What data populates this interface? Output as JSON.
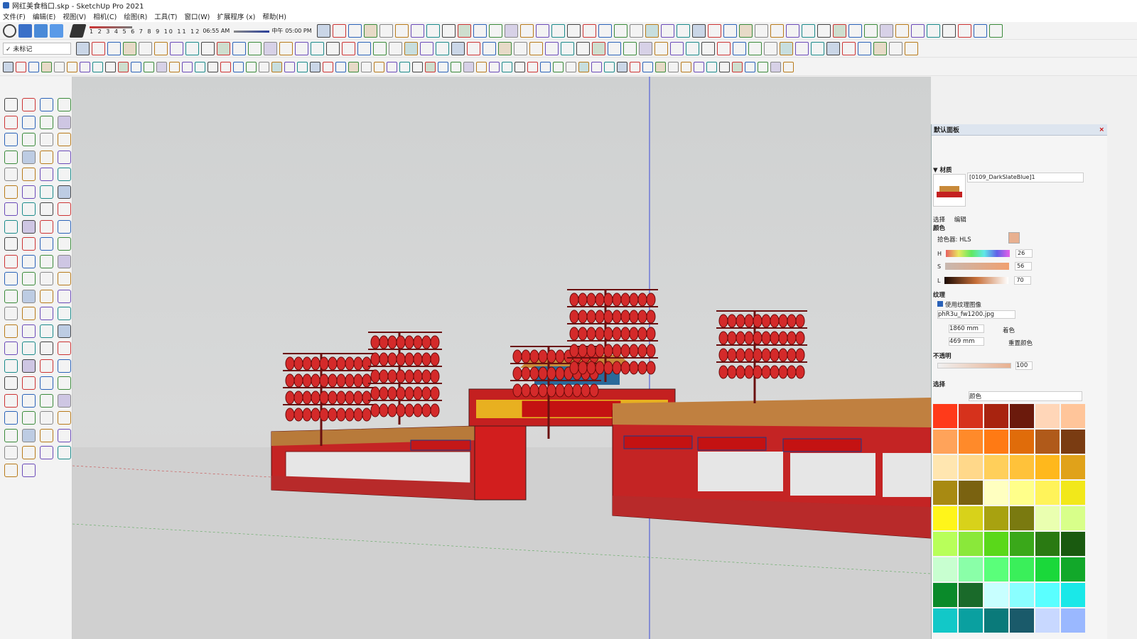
{
  "window": {
    "title": "网红美食档口.skp - SketchUp Pro 2021"
  },
  "menu": {
    "items": [
      "文件(F)",
      "编辑(E)",
      "视图(V)",
      "相机(C)",
      "绘图(R)",
      "工具(T)",
      "窗口(W)",
      "扩展程序 (x)",
      "帮助(H)"
    ]
  },
  "shadow_bar": {
    "months": "1 2 3 4 5 6 7 8 9 10 11 12",
    "time_start": "06:55 AM",
    "noon": "中午",
    "time_end": "05:00 PM"
  },
  "tag_select": {
    "value": "✓ 未标记"
  },
  "colors": {
    "accent": "#2a62b8",
    "stall_red": "#d42a2a",
    "sky": "#d3d4d4"
  },
  "panel": {
    "title": "默认面板",
    "close": "×",
    "materials_section": "▼ 材质",
    "material_name": "[0109_DarkSlateBlue]1",
    "tab_select": "选择",
    "tab_edit": "编辑",
    "color_header": "颜色",
    "picker_label": "拾色器: HLS",
    "h_label": "H",
    "h_value": "26",
    "s_label": "S",
    "s_value": "56",
    "l_label": "L",
    "l_value": "70",
    "texture_header": "纹理",
    "use_texture": "使用纹理图像",
    "texture_file": "phR3u_fw1200.jpg",
    "width_value": "1860 mm",
    "height_value": "469 mm",
    "colorize": "着色",
    "reset_color": "重置颜色",
    "opacity_header": "不透明",
    "opacity_value": "100",
    "select_header": "选择",
    "library": "颜色",
    "swatches": [
      "#ff3a1a",
      "#d6321c",
      "#a8230f",
      "#6b1a0c",
      "#ffd6b8",
      "#ffc59a",
      "#ffa35a",
      "#ff8a2a",
      "#ff7a14",
      "#e06c0a",
      "#b05a1a",
      "#7a3c12",
      "#ffe6b0",
      "#ffd88a",
      "#ffcf5a",
      "#ffc23a",
      "#ffb81c",
      "#e0a21a",
      "#a88a12",
      "#7a6210",
      "#ffffc0",
      "#ffff8a",
      "#fff35a",
      "#f2e81a",
      "#fff51a",
      "#d8d21a",
      "#a8a210",
      "#7a7a10",
      "#eaffb0",
      "#d8ff8a",
      "#b8ff5a",
      "#8ae83a",
      "#5ad81a",
      "#3aa81a",
      "#2a7a12",
      "#1a5a10",
      "#c8ffd0",
      "#8affa8",
      "#5aff7a",
      "#3aef5a",
      "#1ad83a",
      "#12a82a",
      "#0a8a2a",
      "#1a6a2a",
      "#c8ffff",
      "#8affff",
      "#5affff",
      "#1ae8e8",
      "#12c8c8",
      "#0aa0a0",
      "#0a7a7a",
      "#1a5a6a",
      "#c8d8ff",
      "#9ab8ff"
    ]
  }
}
